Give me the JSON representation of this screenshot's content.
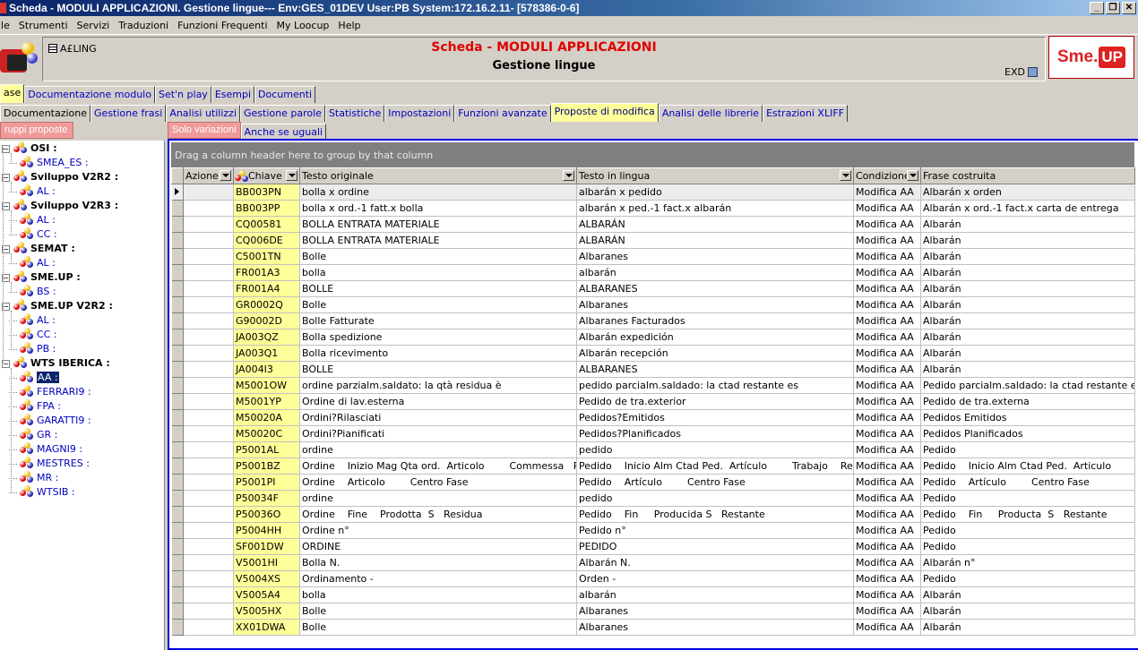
{
  "window": {
    "title": "Scheda - MODULI APPLICAZIONI. Gestione lingue--- Env:GES_01DEV User:PB System:172.16.2.11- [578386-0-6]"
  },
  "menu": [
    "ile",
    "Strumenti",
    "Servizi",
    "Traduzioni",
    "Funzioni Frequenti",
    "My Loocup",
    "Help"
  ],
  "header": {
    "code": "A£LING",
    "title": "Scheda - MODULI APPLICAZIONI",
    "subtitle": "Gestione lingue",
    "exd": "EXD",
    "brand1": "Sme.",
    "brand2": "UP"
  },
  "tabs1": [
    "ase",
    "Documentazione modulo",
    "Set'n play",
    "Esempi",
    "Documenti"
  ],
  "tabs2": [
    "Documentazione",
    "Gestione frasi",
    "Analisi utilizzi",
    "Gestione parole",
    "Statistiche",
    "Impostazioni",
    "Funzioni avanzate",
    "Proposte di modifica",
    "Analisi delle librerie",
    "Estrazioni XLIFF"
  ],
  "tabs3": [
    "ruppi proposte"
  ],
  "tabs4": [
    "Solo variazioni",
    "Anche se uguali"
  ],
  "tree": [
    {
      "label": "OSI :",
      "root": true
    },
    {
      "label": "SMEA_ES :"
    },
    {
      "label": "Sviluppo V2R2 :",
      "root": true
    },
    {
      "label": "AL :"
    },
    {
      "label": "Sviluppo V2R3 :",
      "root": true
    },
    {
      "label": "AL :"
    },
    {
      "label": "CC :"
    },
    {
      "label": "SEMAT :",
      "root": true
    },
    {
      "label": "AL :"
    },
    {
      "label": "SME.UP :",
      "root": true
    },
    {
      "label": "BS :"
    },
    {
      "label": "SME.UP V2R2 :",
      "root": true
    },
    {
      "label": "AL :"
    },
    {
      "label": "CC :"
    },
    {
      "label": "PB :"
    },
    {
      "label": "WTS IBERICA :",
      "root": true
    },
    {
      "label": "AA :",
      "selected": true
    },
    {
      "label": "FERRARI9 :"
    },
    {
      "label": "FPA :"
    },
    {
      "label": "GARATTI9 :"
    },
    {
      "label": "GR :"
    },
    {
      "label": "MAGNI9 :"
    },
    {
      "label": "MESTRES :"
    },
    {
      "label": "MR :"
    },
    {
      "label": "WTSIB :"
    }
  ],
  "grid": {
    "group_hint": "Drag a column header here to group by that column",
    "columns": [
      "Azione",
      "Chiave",
      "Testo originale",
      "Testo in lingua",
      "Condizione",
      "Frase costruita"
    ],
    "rows": [
      [
        "",
        "BB003PN",
        "bolla x ordine",
        "albarán x pedido",
        "Modifica AA",
        "Albarán x orden"
      ],
      [
        "",
        "BB003PP",
        "bolla x ord.-1 fatt.x bolla",
        "albarán x ped.-1 fact.x albarán",
        "Modifica AA",
        "Albarán x ord.-1 fact.x carta de entrega"
      ],
      [
        "",
        "CQ00581",
        "BOLLA ENTRATA MATERIALE",
        "ALBARÁN",
        "Modifica AA",
        "Albarán"
      ],
      [
        "",
        "CQ006DE",
        "BOLLA ENTRATA MATERIALE",
        "ALBARÁN",
        "Modifica AA",
        "Albarán"
      ],
      [
        "",
        "C5001TN",
        "Bolle",
        "Albaranes",
        "Modifica AA",
        "Albarán"
      ],
      [
        "",
        "FR001A3",
        "bolla",
        "albarán",
        "Modifica AA",
        "Albarán"
      ],
      [
        "",
        "FR001A4",
        "BOLLE",
        "ALBARANES",
        "Modifica AA",
        "Albarán"
      ],
      [
        "",
        "GR0002Q",
        "Bolle",
        "Albaranes",
        "Modifica AA",
        "Albarán"
      ],
      [
        "",
        "G90002D",
        "Bolle Fatturate",
        "Albaranes Facturados",
        "Modifica AA",
        "Albarán"
      ],
      [
        "",
        "JA003QZ",
        "Bolla spedizione",
        "Albarán expedición",
        "Modifica AA",
        "Albarán"
      ],
      [
        "",
        "JA003Q1",
        "Bolla ricevimento",
        "Albarán recepción",
        "Modifica AA",
        "Albarán"
      ],
      [
        "",
        "JA004I3",
        "BOLLE",
        "ALBARANES",
        "Modifica AA",
        "Albarán"
      ],
      [
        "",
        "M5001OW",
        "ordine parzialm.saldato: la qtà residua è",
        "pedido parcialm.saldado: la ctad restante es",
        "Modifica AA",
        "Pedido parcialm.saldado: la ctad restante es"
      ],
      [
        "",
        "M5001YP",
        "Ordine di lav.esterna",
        "Pedido de tra.exterior",
        "Modifica AA",
        "Pedido de tra.externa"
      ],
      [
        "",
        "M50020A",
        "Ordini?Rilasciati",
        "Pedidos?Emitidos",
        "Modifica AA",
        "Pedidos Emitidos"
      ],
      [
        "",
        "M50020C",
        "Ordini?Pianificati",
        "Pedidos?Planificados",
        "Modifica AA",
        "Pedidos Planificados"
      ],
      [
        "",
        "P5001AL",
        "ordine",
        "pedido",
        "Modifica AA",
        "Pedido"
      ],
      [
        "",
        "P5001BZ",
        "Ordine    Inizio Mag Qta ord.  Articolo        Commessa   Risorsa",
        "Pedido    Inicio Alm Ctad Ped.  Artículo        Trabajo    Recurso",
        "Modifica AA",
        "Pedido    Inicio Alm Ctad Ped.  Articulo        Trabajo"
      ],
      [
        "",
        "P5001PI",
        "Ordine    Articolo        Centro Fase",
        "Pedido    Artículo        Centro Fase",
        "Modifica AA",
        "Pedido    Artículo        Centro Fase"
      ],
      [
        "",
        "P50034F",
        "ordine",
        "pedido",
        "Modifica AA",
        "Pedido"
      ],
      [
        "",
        "P50036O",
        "Ordine    Fine    Prodotta  S   Residua",
        "Pedido    Fin     Producida S   Restante",
        "Modifica AA",
        "Pedido    Fin     Producta  S   Restante"
      ],
      [
        "",
        "P5004HH",
        "Ordine n°",
        "Pedido n°",
        "Modifica AA",
        "Pedido"
      ],
      [
        "",
        "SF001DW",
        "ORDINE",
        "PEDIDO",
        "Modifica AA",
        "Pedido"
      ],
      [
        "",
        "V5001HI",
        "Bolla N.",
        "Albarán N.",
        "Modifica AA",
        "Albarán n°"
      ],
      [
        "",
        "V5004XS",
        "Ordinamento -",
        "Orden -",
        "Modifica AA",
        "Pedido"
      ],
      [
        "",
        "V5005A4",
        "bolla",
        "albarán",
        "Modifica AA",
        "Albarán"
      ],
      [
        "",
        "V5005HX",
        "Bolle",
        "Albaranes",
        "Modifica AA",
        "Albarán"
      ],
      [
        "",
        "XX01DWA",
        "Bolle",
        "Albaranes",
        "Modifica AA",
        "Albarán"
      ]
    ]
  }
}
